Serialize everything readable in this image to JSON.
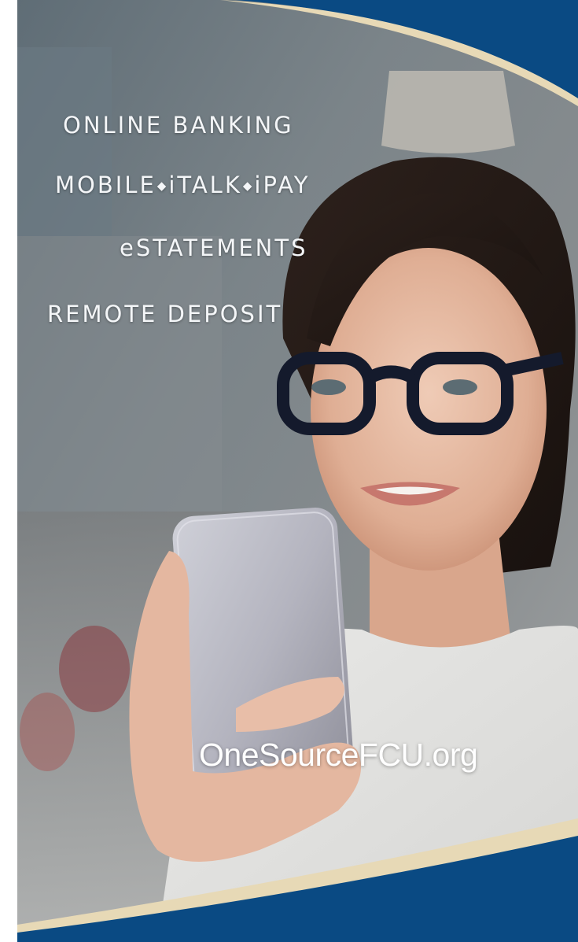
{
  "colors": {
    "navy": "#0a4a83",
    "cream": "#e7d9b6",
    "white": "#ffffff",
    "text": "#f4f6f8"
  },
  "services": {
    "online_banking": "ONLINE BANKING",
    "mobile_line": {
      "mobile": "MOBILE",
      "italk": "iTALK",
      "ipay": "iPAY",
      "separator": "◆"
    },
    "estatements": "eSTATEMENTS",
    "remote_deposit": "REMOTE DEPOSIT"
  },
  "website": "OneSourceFCU.org"
}
